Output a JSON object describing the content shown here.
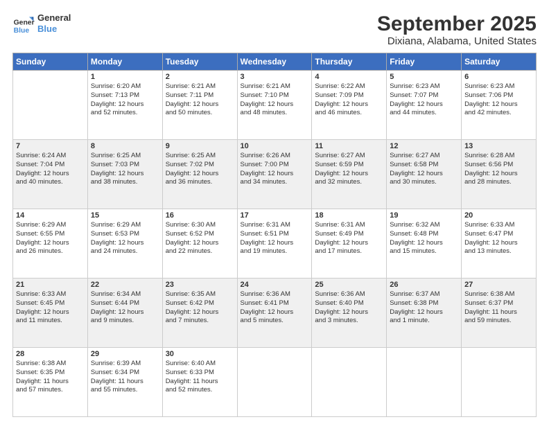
{
  "header": {
    "logo_line1": "General",
    "logo_line2": "Blue",
    "title": "September 2025",
    "subtitle": "Dixiana, Alabama, United States"
  },
  "columns": [
    "Sunday",
    "Monday",
    "Tuesday",
    "Wednesday",
    "Thursday",
    "Friday",
    "Saturday"
  ],
  "weeks": [
    [
      {
        "day": "",
        "info": ""
      },
      {
        "day": "1",
        "info": "Sunrise: 6:20 AM\nSunset: 7:13 PM\nDaylight: 12 hours\nand 52 minutes."
      },
      {
        "day": "2",
        "info": "Sunrise: 6:21 AM\nSunset: 7:11 PM\nDaylight: 12 hours\nand 50 minutes."
      },
      {
        "day": "3",
        "info": "Sunrise: 6:21 AM\nSunset: 7:10 PM\nDaylight: 12 hours\nand 48 minutes."
      },
      {
        "day": "4",
        "info": "Sunrise: 6:22 AM\nSunset: 7:09 PM\nDaylight: 12 hours\nand 46 minutes."
      },
      {
        "day": "5",
        "info": "Sunrise: 6:23 AM\nSunset: 7:07 PM\nDaylight: 12 hours\nand 44 minutes."
      },
      {
        "day": "6",
        "info": "Sunrise: 6:23 AM\nSunset: 7:06 PM\nDaylight: 12 hours\nand 42 minutes."
      }
    ],
    [
      {
        "day": "7",
        "info": "Sunrise: 6:24 AM\nSunset: 7:04 PM\nDaylight: 12 hours\nand 40 minutes."
      },
      {
        "day": "8",
        "info": "Sunrise: 6:25 AM\nSunset: 7:03 PM\nDaylight: 12 hours\nand 38 minutes."
      },
      {
        "day": "9",
        "info": "Sunrise: 6:25 AM\nSunset: 7:02 PM\nDaylight: 12 hours\nand 36 minutes."
      },
      {
        "day": "10",
        "info": "Sunrise: 6:26 AM\nSunset: 7:00 PM\nDaylight: 12 hours\nand 34 minutes."
      },
      {
        "day": "11",
        "info": "Sunrise: 6:27 AM\nSunset: 6:59 PM\nDaylight: 12 hours\nand 32 minutes."
      },
      {
        "day": "12",
        "info": "Sunrise: 6:27 AM\nSunset: 6:58 PM\nDaylight: 12 hours\nand 30 minutes."
      },
      {
        "day": "13",
        "info": "Sunrise: 6:28 AM\nSunset: 6:56 PM\nDaylight: 12 hours\nand 28 minutes."
      }
    ],
    [
      {
        "day": "14",
        "info": "Sunrise: 6:29 AM\nSunset: 6:55 PM\nDaylight: 12 hours\nand 26 minutes."
      },
      {
        "day": "15",
        "info": "Sunrise: 6:29 AM\nSunset: 6:53 PM\nDaylight: 12 hours\nand 24 minutes."
      },
      {
        "day": "16",
        "info": "Sunrise: 6:30 AM\nSunset: 6:52 PM\nDaylight: 12 hours\nand 22 minutes."
      },
      {
        "day": "17",
        "info": "Sunrise: 6:31 AM\nSunset: 6:51 PM\nDaylight: 12 hours\nand 19 minutes."
      },
      {
        "day": "18",
        "info": "Sunrise: 6:31 AM\nSunset: 6:49 PM\nDaylight: 12 hours\nand 17 minutes."
      },
      {
        "day": "19",
        "info": "Sunrise: 6:32 AM\nSunset: 6:48 PM\nDaylight: 12 hours\nand 15 minutes."
      },
      {
        "day": "20",
        "info": "Sunrise: 6:33 AM\nSunset: 6:47 PM\nDaylight: 12 hours\nand 13 minutes."
      }
    ],
    [
      {
        "day": "21",
        "info": "Sunrise: 6:33 AM\nSunset: 6:45 PM\nDaylight: 12 hours\nand 11 minutes."
      },
      {
        "day": "22",
        "info": "Sunrise: 6:34 AM\nSunset: 6:44 PM\nDaylight: 12 hours\nand 9 minutes."
      },
      {
        "day": "23",
        "info": "Sunrise: 6:35 AM\nSunset: 6:42 PM\nDaylight: 12 hours\nand 7 minutes."
      },
      {
        "day": "24",
        "info": "Sunrise: 6:36 AM\nSunset: 6:41 PM\nDaylight: 12 hours\nand 5 minutes."
      },
      {
        "day": "25",
        "info": "Sunrise: 6:36 AM\nSunset: 6:40 PM\nDaylight: 12 hours\nand 3 minutes."
      },
      {
        "day": "26",
        "info": "Sunrise: 6:37 AM\nSunset: 6:38 PM\nDaylight: 12 hours\nand 1 minute."
      },
      {
        "day": "27",
        "info": "Sunrise: 6:38 AM\nSunset: 6:37 PM\nDaylight: 11 hours\nand 59 minutes."
      }
    ],
    [
      {
        "day": "28",
        "info": "Sunrise: 6:38 AM\nSunset: 6:35 PM\nDaylight: 11 hours\nand 57 minutes."
      },
      {
        "day": "29",
        "info": "Sunrise: 6:39 AM\nSunset: 6:34 PM\nDaylight: 11 hours\nand 55 minutes."
      },
      {
        "day": "30",
        "info": "Sunrise: 6:40 AM\nSunset: 6:33 PM\nDaylight: 11 hours\nand 52 minutes."
      },
      {
        "day": "",
        "info": ""
      },
      {
        "day": "",
        "info": ""
      },
      {
        "day": "",
        "info": ""
      },
      {
        "day": "",
        "info": ""
      }
    ]
  ]
}
